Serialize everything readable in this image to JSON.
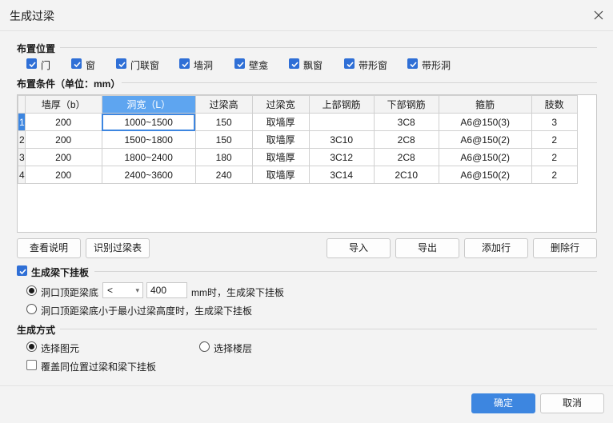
{
  "window": {
    "title": "生成过梁"
  },
  "placement": {
    "label": "布置位置",
    "options": [
      {
        "label": "门",
        "checked": true
      },
      {
        "label": "窗",
        "checked": true
      },
      {
        "label": "门联窗",
        "checked": true
      },
      {
        "label": "墙洞",
        "checked": true
      },
      {
        "label": "壁龛",
        "checked": true
      },
      {
        "label": "飘窗",
        "checked": true
      },
      {
        "label": "带形窗",
        "checked": true
      },
      {
        "label": "带形洞",
        "checked": true
      }
    ]
  },
  "conditions": {
    "label": "布置条件（单位：mm）",
    "columns": [
      "墙厚（b）",
      "洞宽（L）",
      "过梁高",
      "过梁宽",
      "上部钢筋",
      "下部钢筋",
      "箍筋",
      "肢数"
    ],
    "rows": [
      {
        "num": "1",
        "cells": [
          "200",
          "1000~1500",
          "150",
          "取墙厚",
          "",
          "3C8",
          "A6@150(3)",
          "3"
        ]
      },
      {
        "num": "2",
        "cells": [
          "200",
          "1500~1800",
          "150",
          "取墙厚",
          "3C10",
          "2C8",
          "A6@150(2)",
          "2"
        ]
      },
      {
        "num": "3",
        "cells": [
          "200",
          "1800~2400",
          "180",
          "取墙厚",
          "3C12",
          "2C8",
          "A6@150(2)",
          "2"
        ]
      },
      {
        "num": "4",
        "cells": [
          "200",
          "2400~3600",
          "240",
          "取墙厚",
          "3C14",
          "2C10",
          "A6@150(2)",
          "2"
        ]
      }
    ]
  },
  "table_buttons": {
    "view_help": "查看说明",
    "recognize_table": "识别过梁表",
    "import": "导入",
    "export": "导出",
    "add_row": "添加行",
    "delete_row": "删除行"
  },
  "hanging_plate": {
    "label": "生成梁下挂板",
    "checked": true,
    "option1_prefix": "洞口顶距梁底",
    "compare_value": "<",
    "distance_value": "400",
    "option1_suffix": "mm时，生成梁下挂板",
    "option2": "洞口顶距梁底小于最小过梁高度时，生成梁下挂板"
  },
  "generation": {
    "label": "生成方式",
    "select_elements": "选择图元",
    "select_floors": "选择楼层",
    "overwrite": "覆盖同位置过梁和梁下挂板"
  },
  "footer": {
    "ok": "确定",
    "cancel": "取消"
  },
  "colors": {
    "accent": "#3d86e0",
    "header_selected": "#5ea5f0"
  }
}
